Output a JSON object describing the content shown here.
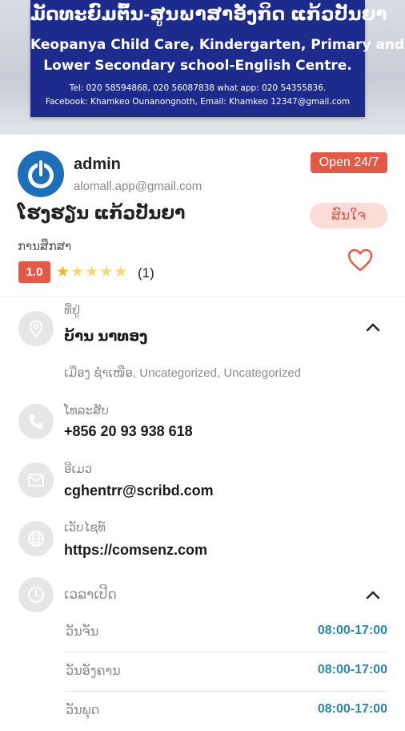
{
  "banner": {
    "title": "ມັດທະຍົມຕົ້ນ-ສູນພາສາອັງກິດ ແກ້ວປັນຍາ",
    "line1": "Keopanya Child Care, Kindergarten, Primary and",
    "line2": "Lower Secondary school-English Centre.",
    "contact1": "Tel: 020 58594868, 020 56087838 what app: 020 54355836.",
    "contact2": "Facebook: Khamkeo Ounanongnoth, Email: Khamkeo 12347@gmail.com"
  },
  "author": {
    "name": "admin",
    "email": "alomall.app@gmail.com",
    "avatar_icon": "power-icon"
  },
  "status_badge": "Open 24/7",
  "listing": {
    "title": "ໂຮງຮຽນ ແກ້ວປັນຍາ",
    "interest_button": "ສົນໃຈ",
    "category": "ການສຶກສາ",
    "rating": "1.0",
    "rating_count": "(1)",
    "stars_filled": 1,
    "stars_total": 5
  },
  "location": {
    "label": "ທີ່ຢູ່",
    "value": "ບ້ານ ນາທອງ",
    "tags": "ເມືອງ ຊຳເໜືອ, Uncategorized, Uncategorized"
  },
  "phone": {
    "label": "ໂທລະສັບ",
    "value": "+856 20 93 938 618"
  },
  "email": {
    "label": "ອີເມວ",
    "value": "cghentrr@scribd.com"
  },
  "website": {
    "label": "ເວັບໄຊທ໌",
    "value": "https://comsenz.com"
  },
  "hours": {
    "label": "ເວລາເປີດ",
    "days": [
      {
        "day": "ວັນຈັນ",
        "time": "08:00-17:00"
      },
      {
        "day": "ວັນອັງຄານ",
        "time": "08:00-17:00"
      },
      {
        "day": "ວັນພຸດ",
        "time": "08:00-17:00"
      }
    ]
  },
  "colors": {
    "accent": "#e25a47",
    "accent_soft": "#fbdcd6",
    "time_blue": "#2a86a8",
    "banner_blue": "#1d2c8c",
    "avatar_blue": "#1f6fb8"
  }
}
